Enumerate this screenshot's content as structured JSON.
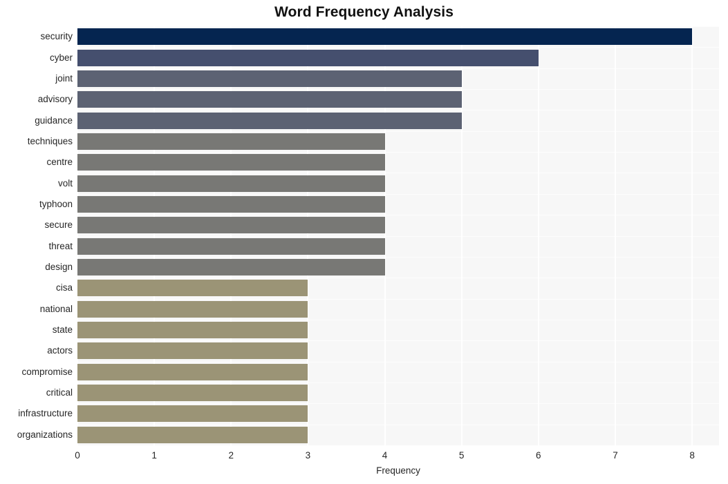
{
  "chart_data": {
    "type": "bar",
    "orientation": "horizontal",
    "title": "Word Frequency Analysis",
    "xlabel": "Frequency",
    "ylabel": "",
    "xlim": [
      0,
      8.35
    ],
    "xticks": [
      0,
      1,
      2,
      3,
      4,
      5,
      6,
      7,
      8
    ],
    "xticklabels": [
      "0",
      "1",
      "2",
      "3",
      "4",
      "5",
      "6",
      "7",
      "8"
    ],
    "grid": true,
    "grid_axis": "both",
    "legend": "none",
    "plot_background": "#f7f7f7",
    "figure_background": "#ffffff",
    "categories": [
      "security",
      "cyber",
      "joint",
      "advisory",
      "guidance",
      "techniques",
      "centre",
      "volt",
      "typhoon",
      "secure",
      "threat",
      "design",
      "cisa",
      "national",
      "state",
      "actors",
      "compromise",
      "critical",
      "infrastructure",
      "organizations"
    ],
    "values": [
      8,
      6,
      5,
      5,
      5,
      4,
      4,
      4,
      4,
      4,
      4,
      4,
      3,
      3,
      3,
      3,
      3,
      3,
      3,
      3
    ],
    "bar_colors": [
      "#052550",
      "#454f6e",
      "#5c6273",
      "#5c6273",
      "#5c6273",
      "#787875",
      "#787875",
      "#787875",
      "#787875",
      "#787875",
      "#787875",
      "#787875",
      "#9b9476",
      "#9b9476",
      "#9b9476",
      "#9b9476",
      "#9b9476",
      "#9b9476",
      "#9b9476",
      "#9b9476"
    ]
  }
}
